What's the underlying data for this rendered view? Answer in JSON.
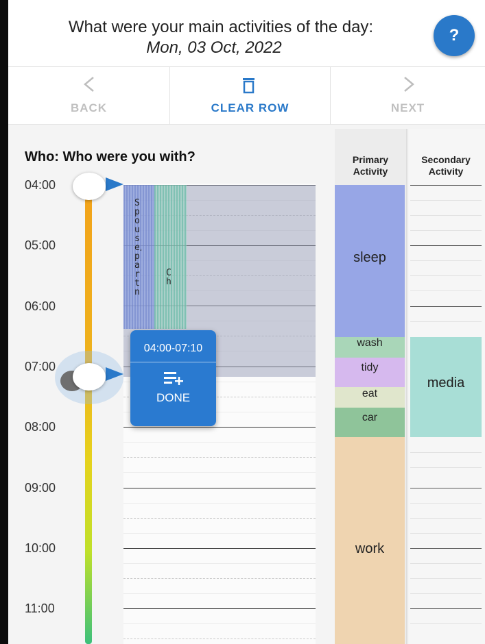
{
  "header": {
    "question": "What were your main activities of the day:",
    "date": "Mon, 03 Oct, 2022",
    "help_label": "?"
  },
  "nav": {
    "back": {
      "icon": "chevron-left-icon",
      "label": "BACK"
    },
    "clear": {
      "icon": "trash-icon",
      "label": "CLEAR ROW"
    },
    "next": {
      "icon": "chevron-right-icon",
      "label": "NEXT"
    }
  },
  "section_title": "Who: Who were you with?",
  "times": [
    "04:00",
    "05:00",
    "06:00",
    "07:00",
    "08:00",
    "09:00",
    "10:00",
    "11:00"
  ],
  "who_columns": [
    {
      "text": "Spouse/partn"
    },
    {
      "text": "Ch"
    }
  ],
  "popup": {
    "range": "04:00-07:10",
    "icon": "add-list-icon",
    "done_label": "DONE"
  },
  "columns": {
    "primary": "Primary Activity",
    "secondary": "Secondary Activity"
  },
  "primary_blocks": [
    {
      "label": "sleep",
      "color": "#97a6e6"
    },
    {
      "label": "wash",
      "color": "#a9d6b8"
    },
    {
      "label": "tidy",
      "color": "#d6b9ee"
    },
    {
      "label": "eat",
      "color": "#e0e6cc"
    },
    {
      "label": "car",
      "color": "#8fc49a"
    },
    {
      "label": "work",
      "color": "#efd4b0"
    }
  ],
  "secondary_blocks": [
    {
      "label": "media",
      "color": "#a8ded6"
    }
  ],
  "colors": {
    "accent": "#2a79c9",
    "timebar_top": "#f2a21a",
    "timebar_bottom": "#3cc07b"
  }
}
